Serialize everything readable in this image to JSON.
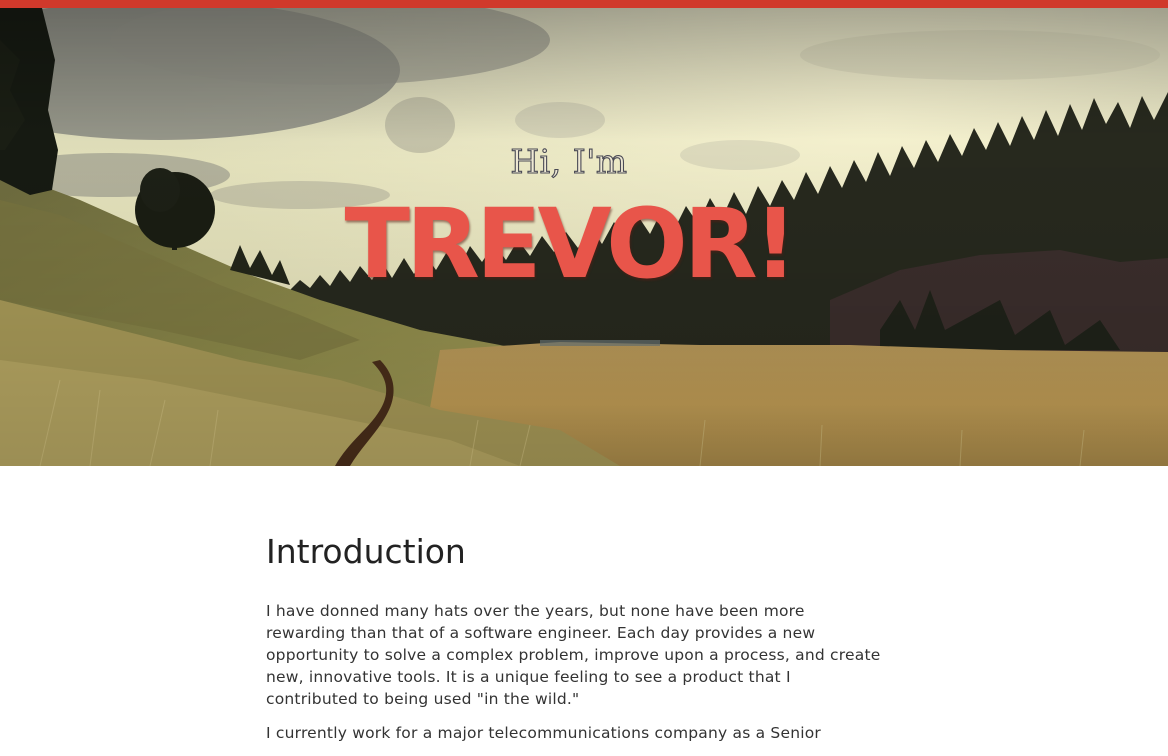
{
  "colors": {
    "accent": "#d0392b",
    "name_red": "#e8554a",
    "text": "#333333",
    "heading": "#222222"
  },
  "hero": {
    "background": "landscape-meadow-forest-photo",
    "greeting": "Hi, I'm",
    "name": "TREVOR!"
  },
  "intro": {
    "heading": "Introduction",
    "paragraphs": [
      "I have donned many hats over the years, but none have been more rewarding than that of a software engineer. Each day provides a new opportunity to solve a complex problem, improve upon a process, and create new, innovative tools. It is a unique feeling to see a product that I contributed to being used \"in the wild.\"",
      "I currently work for a major telecommunications company as a Senior"
    ]
  }
}
